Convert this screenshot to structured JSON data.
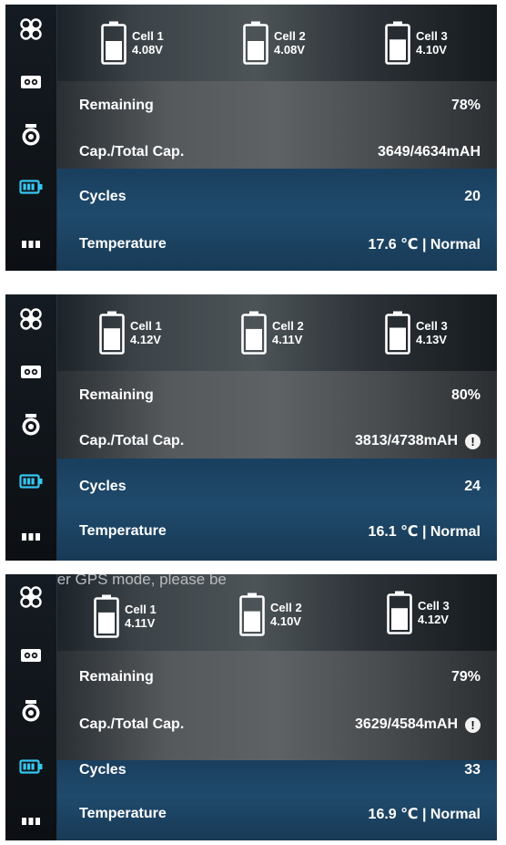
{
  "panels": [
    {
      "notice": "",
      "cells": [
        {
          "label": "Cell 1",
          "voltage": "4.08V",
          "level": 0.6
        },
        {
          "label": "Cell 2",
          "voltage": "4.08V",
          "level": 0.6
        },
        {
          "label": "Cell 3",
          "voltage": "4.10V",
          "level": 0.65
        }
      ],
      "rows": {
        "remaining_label": "Remaining",
        "remaining_value": "78%",
        "capacity_label": "Cap./Total Cap.",
        "capacity_value": "3649/4634mAH",
        "cycles_label": "Cycles",
        "cycles_value": "20",
        "temperature_label": "Temperature",
        "temperature_value": "17.6 ℃ | Normal"
      },
      "show_info": false
    },
    {
      "notice": "",
      "cells": [
        {
          "label": "Cell 1",
          "voltage": "4.12V",
          "level": 0.68
        },
        {
          "label": "Cell 2",
          "voltage": "4.11V",
          "level": 0.66
        },
        {
          "label": "Cell 3",
          "voltage": "4.13V",
          "level": 0.7
        }
      ],
      "rows": {
        "remaining_label": "Remaining",
        "remaining_value": "80%",
        "capacity_label": "Cap./Total Cap.",
        "capacity_value": "3813/4738mAH",
        "cycles_label": "Cycles",
        "cycles_value": "24",
        "temperature_label": "Temperature",
        "temperature_value": "16.1 ℃ | Normal"
      },
      "show_info": true
    },
    {
      "notice": "e to enter GPS mode, please be",
      "cells": [
        {
          "label": "Cell 1",
          "voltage": "4.11V",
          "level": 0.66
        },
        {
          "label": "Cell 2",
          "voltage": "4.10V",
          "level": 0.64
        },
        {
          "label": "Cell 3",
          "voltage": "4.12V",
          "level": 0.68
        }
      ],
      "rows": {
        "remaining_label": "Remaining",
        "remaining_value": "79%",
        "capacity_label": "Cap./Total Cap.",
        "capacity_value": "3629/4584mAH",
        "cycles_label": "Cycles",
        "cycles_value": "33",
        "temperature_label": "Temperature",
        "temperature_value": "16.9 ℃ | Normal"
      },
      "show_info": true
    }
  ],
  "info_icon": "!",
  "rail_icons": [
    "propeller-icon",
    "gimbal-icon",
    "camera-icon",
    "battery-icon",
    "more-icon"
  ],
  "colors": {
    "active_icon": "#35c6f0",
    "icon": "#ffffff",
    "rail_bg": "#12171d"
  }
}
